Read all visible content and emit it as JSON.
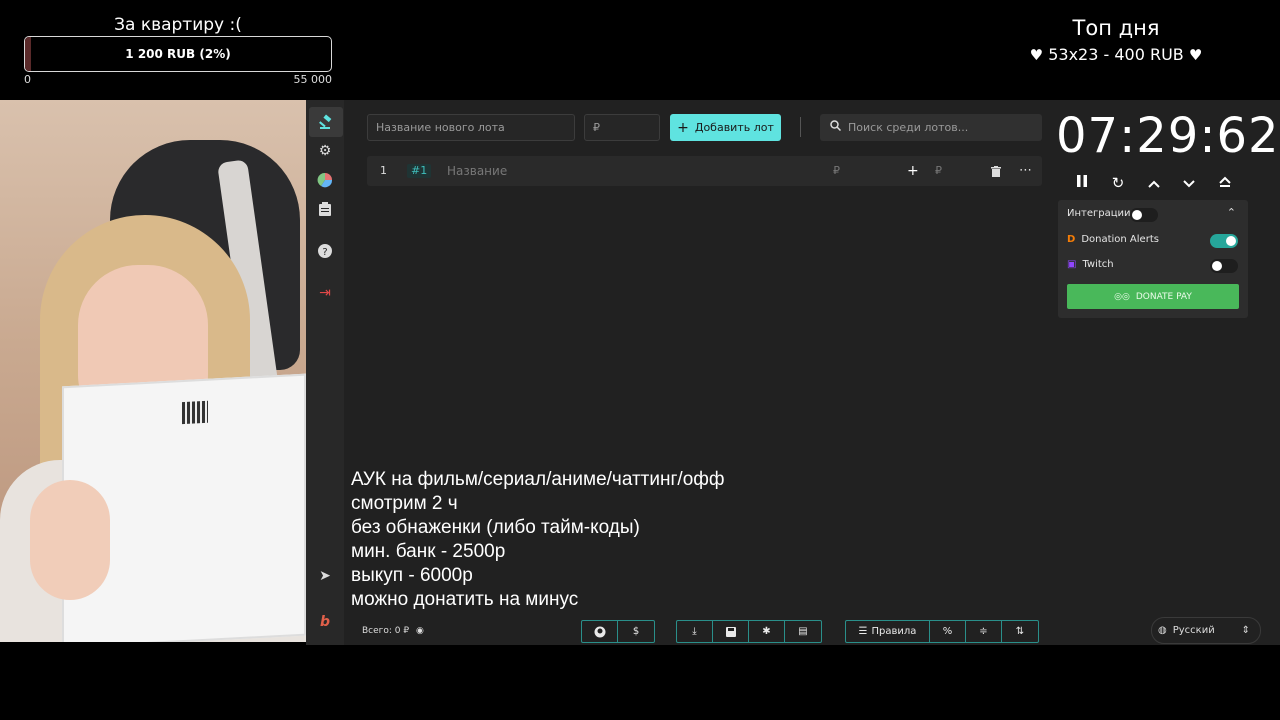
{
  "overlay": {
    "goal_title": "За квартиру :(",
    "goal_text": "1 200 RUB (2%)",
    "goal_progress_percent": 2,
    "goal_min": "0",
    "goal_max": "55 000",
    "top_day_title": "Топ дня",
    "top_day_value": "53x23 - 400 RUB"
  },
  "app": {
    "new_lot_placeholder": "Название нового лота",
    "amount_placeholder": "₽",
    "add_lot_label": "Добавить лот",
    "search_placeholder": "Поиск среди лотов...",
    "lot": {
      "index": "1",
      "tag": "#1",
      "name_placeholder": "Название",
      "amount_symbol": "₽",
      "add_symbol": "₽"
    },
    "timer": "07:29:62",
    "integrations": {
      "title": "Интеграции",
      "items": [
        {
          "label": "Donation Alerts",
          "enabled": true
        },
        {
          "label": "Twitch",
          "enabled": false
        }
      ],
      "donatepay_label": "DONATE PAY"
    },
    "total": "Всего: 0 ₽",
    "toolbar": {
      "rules_label": "Правила"
    },
    "language": "Русский"
  },
  "rules_text": [
    "АУК на фильм/сериал/аниме/чаттинг/офф",
    "смотрим 2 ч",
    "без обнаженки (либо тайм-коды)",
    "мин. банк - 2500р",
    "выкуп - 6000р",
    "можно донатить на минус"
  ],
  "colors": {
    "accent": "#5fe3e0",
    "toggle_on": "#26a69a",
    "donatepay": "#49b85a",
    "exit": "#e04848"
  }
}
